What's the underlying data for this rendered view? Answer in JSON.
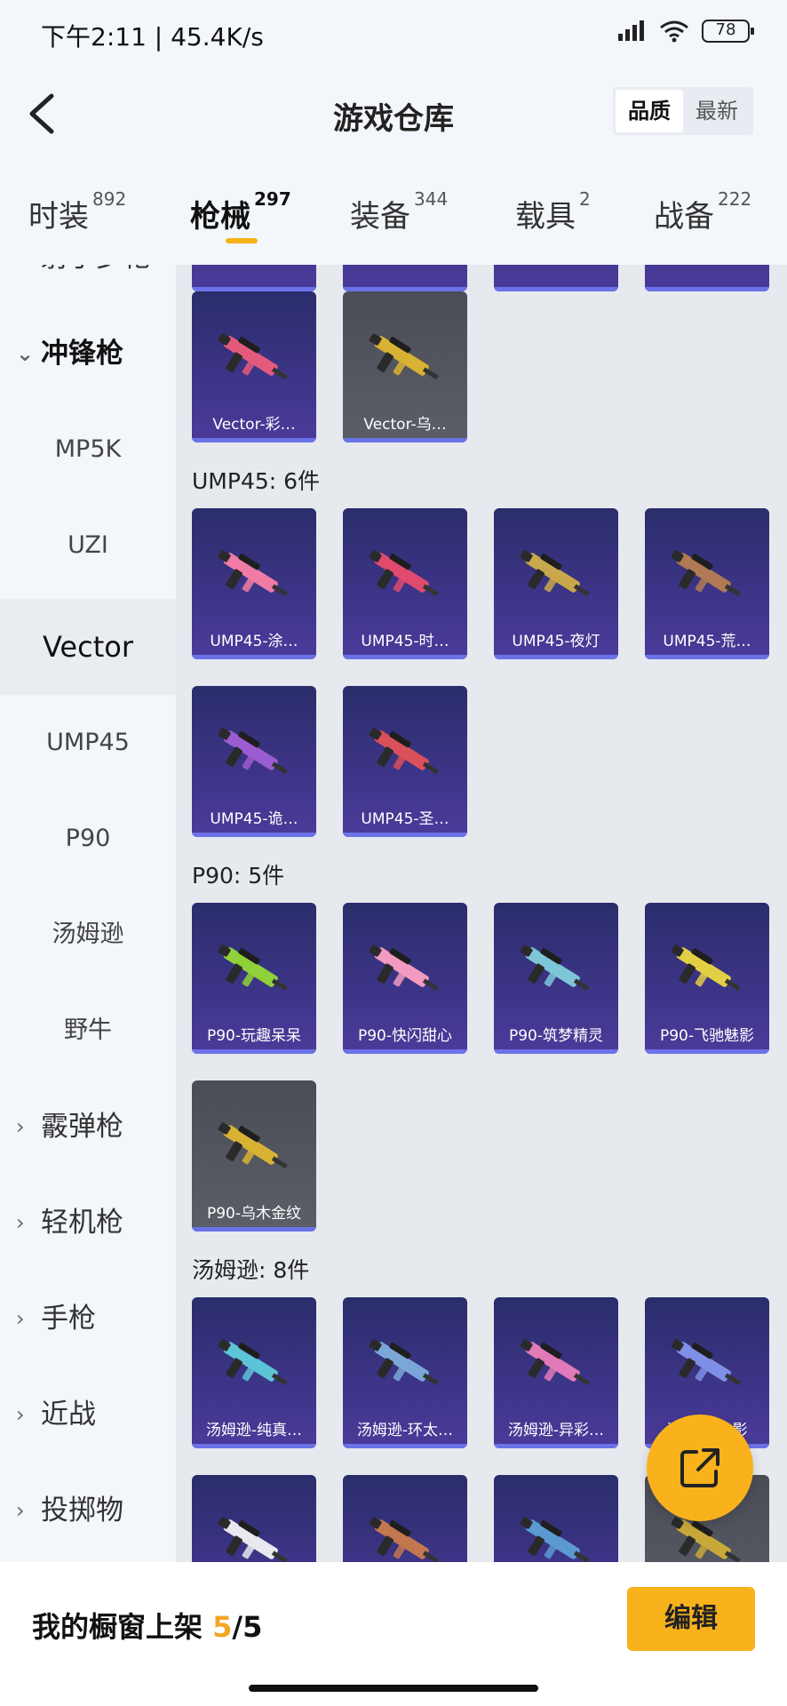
{
  "status_bar": {
    "time_speed": "下午2:11 | 45.4K/s",
    "battery": "78"
  },
  "header": {
    "title": "游戏仓库",
    "sort_quality": "品质",
    "sort_newest": "最新"
  },
  "tabs": [
    {
      "label": "时装",
      "count": "892"
    },
    {
      "label": "枪械",
      "count": "297"
    },
    {
      "label": "装备",
      "count": "344"
    },
    {
      "label": "载具",
      "count": "2"
    },
    {
      "label": "战备",
      "count": "222"
    }
  ],
  "sidebar": {
    "partial_top": "射手步枪",
    "items": [
      {
        "label": "冲锋枪",
        "type": "group-open"
      },
      {
        "label": "MP5K",
        "type": "sub"
      },
      {
        "label": "UZI",
        "type": "sub"
      },
      {
        "label": "Vector",
        "type": "sub-selected"
      },
      {
        "label": "UMP45",
        "type": "sub"
      },
      {
        "label": "P90",
        "type": "sub"
      },
      {
        "label": "汤姆逊",
        "type": "sub"
      },
      {
        "label": "野牛",
        "type": "sub"
      },
      {
        "label": "霰弹枪",
        "type": "group"
      },
      {
        "label": "轻机枪",
        "type": "group"
      },
      {
        "label": "手枪",
        "type": "group"
      },
      {
        "label": "近战",
        "type": "group"
      },
      {
        "label": "投掷物",
        "type": "group"
      }
    ]
  },
  "sections": [
    {
      "label": "",
      "cards": [
        {
          "label": "Vector-彩…",
          "color": "#e35a7c"
        },
        {
          "label": "Vector-乌…",
          "color": "#d8b233"
        }
      ]
    },
    {
      "label": "UMP45: 6件",
      "cards": [
        {
          "label": "UMP45-涂…",
          "color": "#f07ca6"
        },
        {
          "label": "UMP45-时…",
          "color": "#e14a6f"
        },
        {
          "label": "UMP45-夜灯",
          "color": "#c8a84a"
        },
        {
          "label": "UMP45-荒…",
          "color": "#b07a54"
        },
        {
          "label": "UMP45-诡…",
          "color": "#9b5bd1"
        },
        {
          "label": "UMP45-圣…",
          "color": "#d9505a"
        }
      ]
    },
    {
      "label": "P90: 5件",
      "cards": [
        {
          "label": "P90-玩趣呆呆",
          "color": "#8fd13a"
        },
        {
          "label": "P90-快闪甜心",
          "color": "#f29ac0"
        },
        {
          "label": "P90-筑梦精灵",
          "color": "#7ec5d8"
        },
        {
          "label": "P90-飞驰魅影",
          "color": "#e3cf44"
        },
        {
          "label": "P90-乌木金纹",
          "color": "#d8b233"
        }
      ]
    },
    {
      "label": "汤姆逊: 8件",
      "cards": [
        {
          "label": "汤姆逊-纯真…",
          "color": "#5cc4d6"
        },
        {
          "label": "汤姆逊-环太…",
          "color": "#7aa7d8"
        },
        {
          "label": "汤姆逊-异彩…",
          "color": "#e07ab8"
        },
        {
          "label": "汤姆逊-…影",
          "color": "#7f8fe8"
        },
        {
          "label": "",
          "color": "#e8e8ee"
        },
        {
          "label": "",
          "color": "#c2774f"
        },
        {
          "label": "",
          "color": "#5a9ad1"
        },
        {
          "label": "",
          "color": "#c9a83a"
        }
      ]
    }
  ],
  "bottom_bar": {
    "showcase_label": "我的橱窗上架",
    "showcase_current": "5",
    "showcase_total": "/5",
    "edit_label": "编辑"
  },
  "colors": {
    "accent": "#f7b21b",
    "card_bg": "#3c3486"
  }
}
